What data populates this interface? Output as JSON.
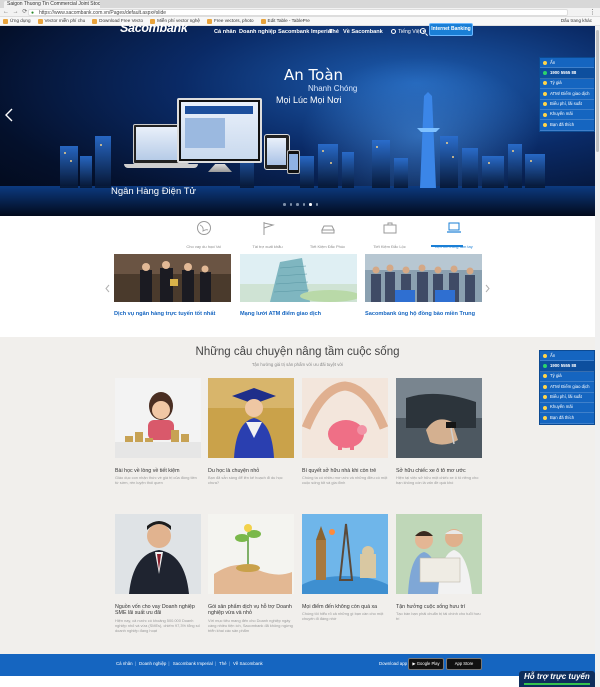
{
  "browser": {
    "tab_title": "Saigon Thuong Tin Commercial Joint Stock Bank (VN)",
    "url": "https://www.sacombank.com.vn/Pages/default.aspx#slide",
    "nav_glyphs": "← → ⟳",
    "menu_glyph": "⋮",
    "bookmarks": [
      "Ứng dụng",
      "Vector miễn phí chu",
      "Download Free Vecto",
      "Miễn phí vector nghệ",
      "Free vectors, photo",
      "Edit Table - TablePre"
    ],
    "bookmarks_right": "Dấu trang khác"
  },
  "header": {
    "logo": "Sacombank",
    "menu": [
      "Cá nhân",
      "Doanh nghiệp",
      "Sacombank Imperial",
      "Thẻ",
      "Về Sacombank"
    ],
    "language": "Tiếng Việt ▾",
    "internet_banking": "Internet Banking"
  },
  "hero": {
    "slogan_line1": "An Toàn",
    "slogan_line2": "Nhanh Chóng",
    "slogan_line3": "Mọi Lúc Mọi Nơi",
    "caption": "Ngân Hàng Điện Tử",
    "slide_count": 6,
    "active_slide": 5
  },
  "side_widget": [
    {
      "label": "Ẩn",
      "icon": "chevron-icon"
    },
    {
      "label": "1900 5555 88",
      "icon": "phone-icon"
    },
    {
      "label": "Tỷ giá",
      "icon": "dollar-icon"
    },
    {
      "label": "ATM/ Điểm giao dịch",
      "icon": "location-icon"
    },
    {
      "label": "Biểu phí, lãi suất",
      "icon": "percent-icon"
    },
    {
      "label": "Khuyến mãi",
      "icon": "gift-icon"
    },
    {
      "label": "Bạn đã thích",
      "icon": "heart-icon"
    }
  ],
  "services": [
    {
      "label": "Cho vay du học/ tái",
      "icon": "globe-icon"
    },
    {
      "label": "Tài trợ xuất khẩu",
      "icon": "flag-icon"
    },
    {
      "label": "Tiết Kiệm Đắc Phúc",
      "icon": "car-icon"
    },
    {
      "label": "Tiết Kiệm Đắc Lộc",
      "icon": "briefcase-icon"
    },
    {
      "label": "Tiện ích trong tầm tay",
      "icon": "laptop-icon"
    }
  ],
  "news": [
    {
      "title": "Dịch vụ ngân hàng trực tuyến tốt nhất"
    },
    {
      "title": "Mạng lưới ATM điểm giao dịch"
    },
    {
      "title": "Sacombank ủng hộ đồng bào miền Trung"
    }
  ],
  "stories": {
    "title": "Những câu chuyện nâng tầm cuộc sống",
    "subtitle": "Tận hưởng giá trị sản phẩm với ưu đãi tuyệt vời",
    "items": [
      {
        "title": "Bài học về lòng về tiết kiệm",
        "desc": "Giáo dục con nhận thức về giá trị của đồng tiền từ sớm, rèn luyện thói quen"
      },
      {
        "title": "Du học là chuyện nhỏ",
        "desc": "Bạn đã sẵn sàng để lên kế hoạch đi du học chưa?"
      },
      {
        "title": "Bí quyết sở hữu nhà khi còn trẻ",
        "desc": "Chúng ta có nhiều mơ ước và những điều có một cuộc sống tốt và gia đình"
      },
      {
        "title": "Sở hữu chiếc xe ô tô mơ ước",
        "desc": "Hiện tại việc sở hữu một chiếc xe ô tô riêng cho bạn không còn là vấn đề quá khó"
      },
      {
        "title": "Nguồn vốn cho vay Doanh nghiệp SME lãi suất ưu đãi",
        "desc": "Hiện nay, cả nước có khoảng 500.000 Doanh nghiệp nhỏ và vừa (SMEs), chiếm 97,3% tổng số doanh nghiệp đang hoạt"
      },
      {
        "title": "Gói sản phẩm dịch vụ hỗ trợ Doanh nghiệp vừa và nhỏ",
        "desc": "Với mục tiêu mang đến cho Doanh nghiệp ngày càng nhiều tiện ích, Sacombank đã không ngừng triển khai các sản phẩm"
      },
      {
        "title": "Mọi điểm đến không còn quá xa",
        "desc": "Chúng tôi hiểu rõ cả những gì bạn cần cho một chuyến đi đáng nhớ"
      },
      {
        "title": "Tận hưởng cuộc sống hưu trí",
        "desc": "Tạo bàn bạn phải chuẩn bị tài chính cho tuổi hưu trí"
      }
    ]
  },
  "footer": {
    "links": [
      "Cá nhân",
      "Doanh nghiệp",
      "Sacombank Imperial",
      "Thẻ",
      "Về Sacombank"
    ],
    "download_label": "Download app",
    "google_play": "▶ Google Play",
    "app_store": " App Store",
    "support_tab": "Hỗ trợ trực tuyến"
  },
  "colors": {
    "brand_blue": "#1565c0",
    "accent_link": "#1a7fd6",
    "section_bg": "#f1efec"
  }
}
